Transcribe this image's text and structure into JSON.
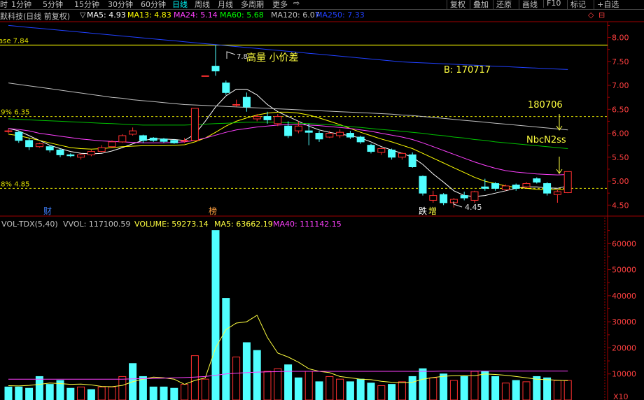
{
  "toolbar": {
    "periods": [
      "时",
      "1分钟",
      "5分钟",
      "15分钟",
      "30分钟",
      "60分钟",
      "日线",
      "周线",
      "月线",
      "多周期",
      "更多"
    ],
    "active_period": "日线",
    "back_icon": "⇨",
    "right_buttons": [
      "复权",
      "叠加",
      "还原",
      "画线",
      "F10",
      "标记",
      "+自选"
    ]
  },
  "title": {
    "stock": "默科技(日线 前复权)",
    "marker": "▽",
    "ma_items": [
      {
        "label": "MA5:",
        "value": "4.93",
        "color": "#ffffff"
      },
      {
        "label": "MA13:",
        "value": "4.83",
        "color": "#ffff00"
      },
      {
        "label": "MA24:",
        "value": "5.14",
        "color": "#ff40ff"
      },
      {
        "label": "MA60:",
        "value": "5.68",
        "color": "#00ff00"
      },
      {
        "label": "MA120:",
        "value": "6.07",
        "color": "#c0c0c0"
      },
      {
        "label": "MA250:",
        "value": "7.33",
        "color": "#2040ff"
      }
    ],
    "corner_icons": [
      "◇",
      "⊟"
    ]
  },
  "annotations": {
    "base_line": "ase 7.84",
    "line_635": ".9% 6.35",
    "line_485": ".8% 4.85",
    "peak_price": "7.8",
    "high_volume_note": "高量 小价差",
    "b_label": "B: 170717",
    "date_180706": "180706",
    "nbc_label": "NbcN2ss",
    "low_price": "4.45",
    "tag_cai": "财",
    "tag_bang": "榜",
    "tag_die": "跌",
    "tag_zeng": "增"
  },
  "volume_header": {
    "name": "VOL-TDX(5,40)",
    "vvol": "VVOL: 117100.59",
    "volume": "VOLUME: 59273.14",
    "ma5": "MA5: 63662.19",
    "ma40": "MA40: 111142.15"
  },
  "x10_label": "X10",
  "chart_data": [
    {
      "type": "candlestick",
      "title": "",
      "ylim": [
        4.3,
        8.3
      ],
      "yticks": [
        "4.50",
        "5.00",
        "5.50",
        "6.00",
        "6.50",
        "7.00",
        "7.50",
        "8.00"
      ],
      "reference_lines": [
        7.84,
        6.35,
        4.85
      ],
      "candles": [
        {
          "o": 6.05,
          "c": 6.05,
          "h": 6.1,
          "l": 6.0
        },
        {
          "o": 6.02,
          "c": 5.85,
          "h": 6.05,
          "l": 5.8
        },
        {
          "o": 5.85,
          "c": 5.72,
          "h": 5.9,
          "l": 5.65
        },
        {
          "o": 5.72,
          "c": 5.78,
          "h": 5.8,
          "l": 5.7
        },
        {
          "o": 5.72,
          "c": 5.65,
          "h": 5.75,
          "l": 5.6
        },
        {
          "o": 5.65,
          "c": 5.55,
          "h": 5.68,
          "l": 5.5
        },
        {
          "o": 5.55,
          "c": 5.53,
          "h": 5.58,
          "l": 5.5
        },
        {
          "o": 5.5,
          "c": 5.55,
          "h": 5.58,
          "l": 5.45
        },
        {
          "o": 5.55,
          "c": 5.62,
          "h": 5.65,
          "l": 5.52
        },
        {
          "o": 5.62,
          "c": 5.7,
          "h": 5.75,
          "l": 5.6
        },
        {
          "o": 5.72,
          "c": 5.82,
          "h": 5.85,
          "l": 5.7
        },
        {
          "o": 5.82,
          "c": 5.95,
          "h": 5.98,
          "l": 5.8
        },
        {
          "o": 5.98,
          "c": 6.05,
          "h": 6.12,
          "l": 5.95
        },
        {
          "o": 5.95,
          "c": 5.85,
          "h": 5.97,
          "l": 5.8
        },
        {
          "o": 5.9,
          "c": 5.85,
          "h": 5.92,
          "l": 5.82
        },
        {
          "o": 5.88,
          "c": 5.83,
          "h": 5.9,
          "l": 5.8
        },
        {
          "o": 5.85,
          "c": 5.8,
          "h": 5.88,
          "l": 5.78
        },
        {
          "o": 5.85,
          "c": 5.85,
          "h": 5.9,
          "l": 5.8
        },
        {
          "o": 5.85,
          "c": 6.52,
          "h": 6.52,
          "l": 5.85
        },
        {
          "o": 7.2,
          "c": 7.2,
          "h": 7.2,
          "l": 7.2
        },
        {
          "o": 7.4,
          "c": 7.3,
          "h": 7.84,
          "l": 7.2
        },
        {
          "o": 7.05,
          "c": 6.85,
          "h": 7.1,
          "l": 6.8
        },
        {
          "o": 6.6,
          "c": 6.6,
          "h": 6.7,
          "l": 6.55
        },
        {
          "o": 6.75,
          "c": 6.55,
          "h": 6.85,
          "l": 6.45
        },
        {
          "o": 6.3,
          "c": 6.35,
          "h": 6.4,
          "l": 6.25
        },
        {
          "o": 6.35,
          "c": 6.28,
          "h": 6.45,
          "l": 6.2
        },
        {
          "o": 6.2,
          "c": 6.35,
          "h": 6.4,
          "l": 6.15
        },
        {
          "o": 6.15,
          "c": 5.95,
          "h": 6.25,
          "l": 5.9
        },
        {
          "o": 6.05,
          "c": 6.15,
          "h": 6.25,
          "l": 6.0
        },
        {
          "o": 6.05,
          "c": 6.02,
          "h": 6.2,
          "l": 5.75
        },
        {
          "o": 6.0,
          "c": 5.88,
          "h": 6.05,
          "l": 5.82
        },
        {
          "o": 5.92,
          "c": 6.0,
          "h": 6.05,
          "l": 5.9
        },
        {
          "o": 5.95,
          "c": 6.02,
          "h": 6.08,
          "l": 5.9
        },
        {
          "o": 6.0,
          "c": 5.92,
          "h": 6.05,
          "l": 5.88
        },
        {
          "o": 5.92,
          "c": 5.82,
          "h": 5.95,
          "l": 5.78
        },
        {
          "o": 5.75,
          "c": 5.62,
          "h": 5.78,
          "l": 5.58
        },
        {
          "o": 5.6,
          "c": 5.68,
          "h": 5.7,
          "l": 5.55
        },
        {
          "o": 5.65,
          "c": 5.5,
          "h": 5.68,
          "l": 5.45
        },
        {
          "o": 5.5,
          "c": 5.58,
          "h": 5.6,
          "l": 5.45
        },
        {
          "o": 5.55,
          "c": 5.3,
          "h": 5.6,
          "l": 5.28
        },
        {
          "o": 5.1,
          "c": 4.75,
          "h": 5.12,
          "l": 4.7
        },
        {
          "o": 4.6,
          "c": 4.7,
          "h": 4.8,
          "l": 4.55
        },
        {
          "o": 4.72,
          "c": 4.55,
          "h": 4.75,
          "l": 4.5
        },
        {
          "o": 4.55,
          "c": 4.62,
          "h": 4.65,
          "l": 4.45
        },
        {
          "o": 4.7,
          "c": 4.65,
          "h": 4.78,
          "l": 4.6
        },
        {
          "o": 4.6,
          "c": 4.78,
          "h": 4.8,
          "l": 4.55
        },
        {
          "o": 4.88,
          "c": 4.85,
          "h": 5.05,
          "l": 4.8
        },
        {
          "o": 4.95,
          "c": 4.85,
          "h": 4.98,
          "l": 4.8
        },
        {
          "o": 4.82,
          "c": 4.9,
          "h": 4.93,
          "l": 4.8
        },
        {
          "o": 4.92,
          "c": 4.85,
          "h": 4.95,
          "l": 4.8
        },
        {
          "o": 4.88,
          "c": 4.95,
          "h": 4.98,
          "l": 4.85
        },
        {
          "o": 5.05,
          "c": 4.98,
          "h": 5.08,
          "l": 4.95
        },
        {
          "o": 4.95,
          "c": 4.75,
          "h": 4.98,
          "l": 4.7
        },
        {
          "o": 4.72,
          "c": 4.78,
          "h": 4.82,
          "l": 4.55
        },
        {
          "o": 4.76,
          "c": 5.2,
          "h": 5.2,
          "l": 4.75
        }
      ],
      "ma_lines": [
        {
          "name": "MA5",
          "color": "#ffffff",
          "values": [
            6.1,
            6.05,
            5.95,
            5.85,
            5.75,
            5.68,
            5.62,
            5.58,
            5.57,
            5.58,
            5.63,
            5.7,
            5.78,
            5.85,
            5.88,
            5.88,
            5.87,
            5.85,
            5.98,
            6.25,
            6.55,
            6.78,
            6.92,
            6.92,
            6.8,
            6.6,
            6.45,
            6.35,
            6.25,
            6.15,
            6.07,
            6.02,
            5.98,
            5.95,
            5.9,
            5.82,
            5.72,
            5.65,
            5.58,
            5.5,
            5.35,
            5.15,
            4.98,
            4.8,
            4.7,
            4.68,
            4.7,
            4.75,
            4.8,
            4.85,
            4.88,
            4.88,
            4.86,
            4.85,
            4.9
          ]
        },
        {
          "name": "MA13",
          "color": "#ffff00",
          "values": [
            5.98,
            5.95,
            5.9,
            5.85,
            5.8,
            5.75,
            5.7,
            5.68,
            5.67,
            5.68,
            5.7,
            5.72,
            5.73,
            5.74,
            5.74,
            5.74,
            5.75,
            5.76,
            5.82,
            5.9,
            6.02,
            6.15,
            6.25,
            6.32,
            6.38,
            6.42,
            6.44,
            6.44,
            6.42,
            6.38,
            6.32,
            6.25,
            6.18,
            6.1,
            6.02,
            5.95,
            5.88,
            5.82,
            5.75,
            5.68,
            5.58,
            5.48,
            5.38,
            5.28,
            5.18,
            5.08,
            5.0,
            4.95,
            4.9,
            4.87,
            4.85,
            4.83,
            4.82,
            4.82,
            4.83
          ]
        },
        {
          "name": "MA24",
          "color": "#ff40ff",
          "values": [
            6.1,
            6.08,
            6.05,
            6.0,
            5.97,
            5.94,
            5.91,
            5.88,
            5.86,
            5.84,
            5.83,
            5.82,
            5.81,
            5.8,
            5.8,
            5.8,
            5.81,
            5.82,
            5.85,
            5.9,
            5.96,
            6.02,
            6.07,
            6.1,
            6.13,
            6.15,
            6.17,
            6.18,
            6.18,
            6.17,
            6.16,
            6.14,
            6.12,
            6.1,
            6.07,
            6.04,
            6.0,
            5.96,
            5.92,
            5.87,
            5.8,
            5.72,
            5.64,
            5.56,
            5.48,
            5.4,
            5.33,
            5.27,
            5.22,
            5.19,
            5.17,
            5.15,
            5.14,
            5.13,
            5.14
          ]
        },
        {
          "name": "MA60",
          "color": "#00c000",
          "values": [
            6.3,
            6.29,
            6.28,
            6.27,
            6.26,
            6.25,
            6.24,
            6.23,
            6.22,
            6.21,
            6.2,
            6.19,
            6.18,
            6.17,
            6.17,
            6.17,
            6.17,
            6.17,
            6.18,
            6.19,
            6.2,
            6.21,
            6.22,
            6.23,
            6.23,
            6.23,
            6.23,
            6.22,
            6.21,
            6.2,
            6.19,
            6.18,
            6.16,
            6.14,
            6.12,
            6.1,
            6.08,
            6.06,
            6.04,
            6.02,
            6.0,
            5.97,
            5.95,
            5.92,
            5.9,
            5.87,
            5.85,
            5.82,
            5.8,
            5.78,
            5.76,
            5.74,
            5.72,
            5.7,
            5.68
          ]
        },
        {
          "name": "MA120",
          "color": "#c0c0c0",
          "values": [
            7.05,
            7.02,
            6.99,
            6.96,
            6.93,
            6.9,
            6.87,
            6.84,
            6.81,
            6.78,
            6.75,
            6.73,
            6.7,
            6.68,
            6.66,
            6.64,
            6.62,
            6.6,
            6.59,
            6.58,
            6.57,
            6.56,
            6.55,
            6.54,
            6.53,
            6.52,
            6.51,
            6.5,
            6.49,
            6.48,
            6.47,
            6.46,
            6.45,
            6.44,
            6.43,
            6.42,
            6.41,
            6.4,
            6.38,
            6.37,
            6.35,
            6.33,
            6.31,
            6.29,
            6.27,
            6.25,
            6.23,
            6.21,
            6.19,
            6.17,
            6.15,
            6.13,
            6.11,
            6.09,
            6.07
          ]
        },
        {
          "name": "MA250",
          "color": "#2040ff",
          "values": [
            8.25,
            8.23,
            8.21,
            8.19,
            8.17,
            8.15,
            8.13,
            8.11,
            8.09,
            8.07,
            8.05,
            8.03,
            8.01,
            7.99,
            7.97,
            7.95,
            7.93,
            7.91,
            7.89,
            7.87,
            7.85,
            7.83,
            7.81,
            7.79,
            7.77,
            7.75,
            7.73,
            7.71,
            7.69,
            7.67,
            7.65,
            7.63,
            7.61,
            7.59,
            7.57,
            7.55,
            7.53,
            7.51,
            7.49,
            7.48,
            7.47,
            7.46,
            7.45,
            7.44,
            7.43,
            7.42,
            7.41,
            7.4,
            7.39,
            7.38,
            7.37,
            7.36,
            7.35,
            7.34,
            7.33
          ]
        }
      ]
    },
    {
      "type": "bar",
      "title": "",
      "ylim": [
        0,
        70000
      ],
      "yticks": [
        "10000",
        "20000",
        "30000",
        "40000",
        "50000",
        "60000"
      ],
      "bars": [
        {
          "v": 5000,
          "up": false
        },
        {
          "v": 5000,
          "up": false
        },
        {
          "v": 4500,
          "up": false
        },
        {
          "v": 9000,
          "up": false
        },
        {
          "v": 6000,
          "up": false
        },
        {
          "v": 7500,
          "up": false
        },
        {
          "v": 4500,
          "up": false
        },
        {
          "v": 5000,
          "up": true
        },
        {
          "v": 4000,
          "up": false
        },
        {
          "v": 5000,
          "up": true
        },
        {
          "v": 5000,
          "up": true
        },
        {
          "v": 9000,
          "up": true
        },
        {
          "v": 14000,
          "up": false
        },
        {
          "v": 9000,
          "up": false
        },
        {
          "v": 5000,
          "up": false
        },
        {
          "v": 5000,
          "up": false
        },
        {
          "v": 4500,
          "up": false
        },
        {
          "v": 6000,
          "up": true
        },
        {
          "v": 17000,
          "up": true
        },
        {
          "v": 8000,
          "up": true
        },
        {
          "v": 65000,
          "up": false
        },
        {
          "v": 39000,
          "up": false
        },
        {
          "v": 16500,
          "up": true
        },
        {
          "v": 22000,
          "up": false
        },
        {
          "v": 19000,
          "up": false
        },
        {
          "v": 11000,
          "up": true
        },
        {
          "v": 12000,
          "up": true
        },
        {
          "v": 13500,
          "up": false
        },
        {
          "v": 8500,
          "up": false
        },
        {
          "v": 11000,
          "up": true
        },
        {
          "v": 7000,
          "up": false
        },
        {
          "v": 9000,
          "up": true
        },
        {
          "v": 8000,
          "up": true
        },
        {
          "v": 7000,
          "up": false
        },
        {
          "v": 8000,
          "up": false
        },
        {
          "v": 6500,
          "up": false
        },
        {
          "v": 5500,
          "up": true
        },
        {
          "v": 6000,
          "up": false
        },
        {
          "v": 7000,
          "up": true
        },
        {
          "v": 9000,
          "up": false
        },
        {
          "v": 12000,
          "up": false
        },
        {
          "v": 8500,
          "up": true
        },
        {
          "v": 10000,
          "up": false
        },
        {
          "v": 7500,
          "up": true
        },
        {
          "v": 9000,
          "up": false
        },
        {
          "v": 11000,
          "up": true
        },
        {
          "v": 11000,
          "up": false
        },
        {
          "v": 9000,
          "up": false
        },
        {
          "v": 6500,
          "up": true
        },
        {
          "v": 7500,
          "up": false
        },
        {
          "v": 7000,
          "up": true
        },
        {
          "v": 9000,
          "up": false
        },
        {
          "v": 8500,
          "up": false
        },
        {
          "v": 7500,
          "up": true
        },
        {
          "v": 7500,
          "up": true
        }
      ],
      "ma5": [
        5500,
        5400,
        5600,
        6000,
        6500,
        6300,
        6000,
        6100,
        5800,
        5200,
        5100,
        5600,
        7000,
        8000,
        8800,
        8500,
        8000,
        6000,
        7500,
        8500,
        20000,
        27000,
        29500,
        30000,
        32500,
        24000,
        18000,
        16500,
        14500,
        12000,
        11000,
        10500,
        9000,
        8500,
        8000,
        7800,
        7200,
        6800,
        6600,
        6800,
        8000,
        8600,
        9100,
        9300,
        9400,
        9300,
        10000,
        9800,
        9500,
        9000,
        8500,
        8000,
        7800,
        7600,
        7400
      ],
      "ma40": [
        8000,
        8000,
        8000,
        8000,
        8000,
        8000,
        8000,
        8000,
        8000,
        8000,
        8000,
        8000,
        8100,
        8200,
        8300,
        8400,
        8500,
        8600,
        8800,
        9000,
        9500,
        10000,
        10300,
        10500,
        10700,
        10800,
        10900,
        11000,
        11000,
        11000,
        11000,
        11000,
        11000,
        11000,
        11000,
        11000,
        11000,
        11000,
        11000,
        11000,
        11000,
        11000,
        11100,
        11100,
        11100,
        11100,
        11100,
        11100,
        11100,
        11100,
        11100,
        11100,
        11100,
        11100,
        11100
      ]
    }
  ]
}
